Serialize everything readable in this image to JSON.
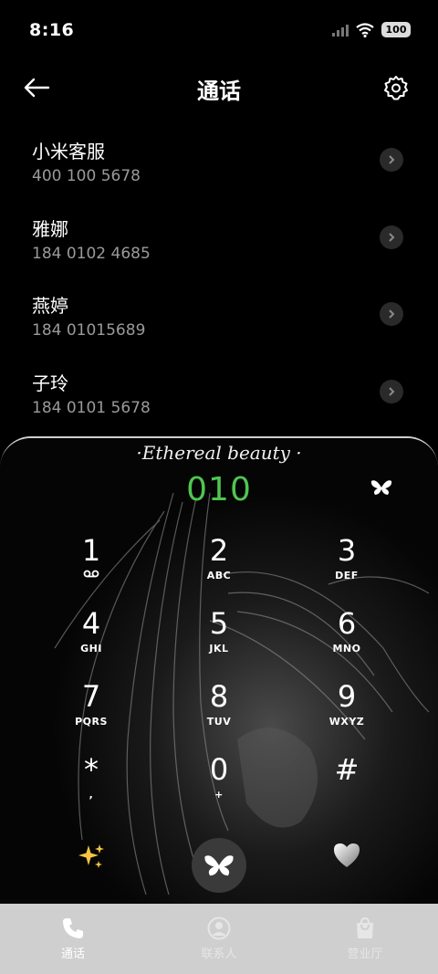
{
  "status_bar": {
    "time": "8:16",
    "battery": "100"
  },
  "header": {
    "title": "通话"
  },
  "contacts": [
    {
      "name": "小米客服",
      "number": "400 100 5678"
    },
    {
      "name": "雅娜",
      "number": "184 0102 4685"
    },
    {
      "name": "燕婷",
      "number": "184 01015689"
    },
    {
      "name": "子玲",
      "number": "184 0101 5678"
    }
  ],
  "dialer": {
    "theme_title": "·Ethereal beauty ·",
    "number": "010",
    "keys": [
      {
        "digit": "1",
        "letters": ""
      },
      {
        "digit": "2",
        "letters": "ABC"
      },
      {
        "digit": "3",
        "letters": "DEF"
      },
      {
        "digit": "4",
        "letters": "GHI"
      },
      {
        "digit": "5",
        "letters": "JKL"
      },
      {
        "digit": "6",
        "letters": "MNO"
      },
      {
        "digit": "7",
        "letters": "PQRS"
      },
      {
        "digit": "8",
        "letters": "TUV"
      },
      {
        "digit": "9",
        "letters": "WXYZ"
      },
      {
        "digit": "*",
        "letters": ","
      },
      {
        "digit": "0",
        "letters": "+"
      },
      {
        "digit": "#",
        "letters": ""
      }
    ]
  },
  "bottom_nav": [
    {
      "label": "通话",
      "icon": "phone-icon",
      "active": true
    },
    {
      "label": "联系人",
      "icon": "person-icon",
      "active": false
    },
    {
      "label": "营业厅",
      "icon": "bag-icon",
      "active": false
    }
  ],
  "colors": {
    "dial_number": "#4fc650",
    "nav_background": "#cfcfcf"
  }
}
